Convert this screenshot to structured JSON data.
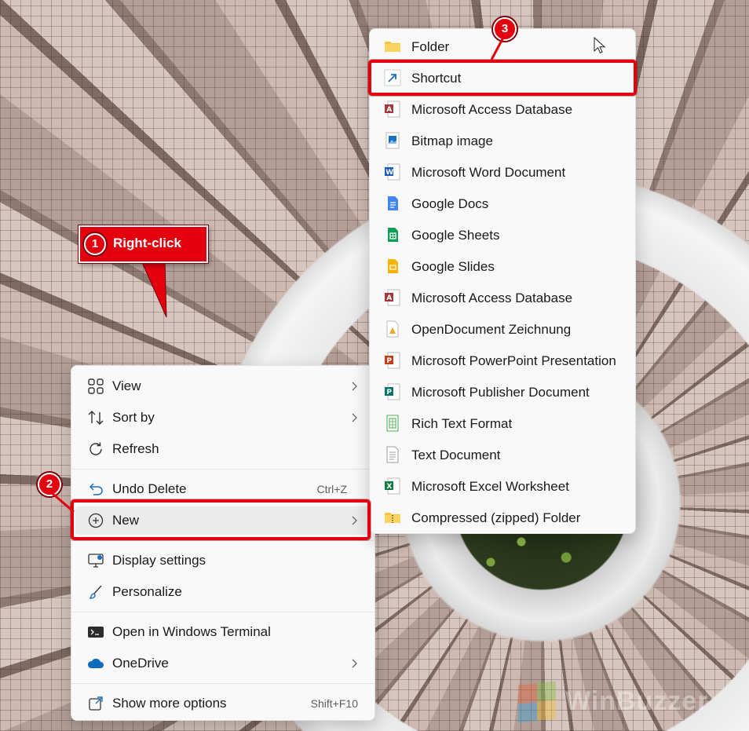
{
  "annotations": {
    "step1_number": "1",
    "step1_label": "Right-click",
    "step2_number": "2",
    "step3_number": "3",
    "highlight_color": "#e3000f"
  },
  "context_menu": {
    "items": [
      {
        "label": "View",
        "icon": "grid-icon",
        "submenu": true
      },
      {
        "label": "Sort by",
        "icon": "sort-icon",
        "submenu": true
      },
      {
        "label": "Refresh",
        "icon": "refresh-icon"
      },
      {
        "label": "Undo Delete",
        "icon": "undo-icon",
        "shortcut": "Ctrl+Z"
      },
      {
        "label": "New",
        "icon": "plus-circle-icon",
        "submenu": true,
        "highlighted": true
      },
      {
        "label": "Display settings",
        "icon": "monitor-icon"
      },
      {
        "label": "Personalize",
        "icon": "brush-icon"
      },
      {
        "label": "Open in Windows Terminal",
        "icon": "terminal-icon"
      },
      {
        "label": "OneDrive",
        "icon": "cloud-icon",
        "submenu": true
      },
      {
        "label": "Show more options",
        "icon": "external-icon",
        "shortcut": "Shift+F10"
      }
    ]
  },
  "new_submenu": {
    "items": [
      {
        "label": "Folder",
        "icon": "folder-icon"
      },
      {
        "label": "Shortcut",
        "icon": "shortcut-icon",
        "highlighted": true
      },
      {
        "label": "Microsoft Access Database",
        "icon": "access-icon"
      },
      {
        "label": "Bitmap image",
        "icon": "bitmap-icon"
      },
      {
        "label": "Microsoft Word Document",
        "icon": "word-icon"
      },
      {
        "label": "Google Docs",
        "icon": "google-docs-icon"
      },
      {
        "label": "Google Sheets",
        "icon": "google-sheets-icon"
      },
      {
        "label": "Google Slides",
        "icon": "google-slides-icon"
      },
      {
        "label": "Microsoft Access Database",
        "icon": "access-icon"
      },
      {
        "label": "OpenDocument Zeichnung",
        "icon": "opendocument-icon"
      },
      {
        "label": "Microsoft PowerPoint Presentation",
        "icon": "powerpoint-icon"
      },
      {
        "label": "Microsoft Publisher Document",
        "icon": "publisher-icon"
      },
      {
        "label": "Rich Text Format",
        "icon": "rtf-icon"
      },
      {
        "label": "Text Document",
        "icon": "text-document-icon"
      },
      {
        "label": "Microsoft Excel Worksheet",
        "icon": "excel-icon"
      },
      {
        "label": "Compressed (zipped) Folder",
        "icon": "zip-folder-icon"
      }
    ]
  },
  "watermark": {
    "text": "WinBuzzer"
  }
}
